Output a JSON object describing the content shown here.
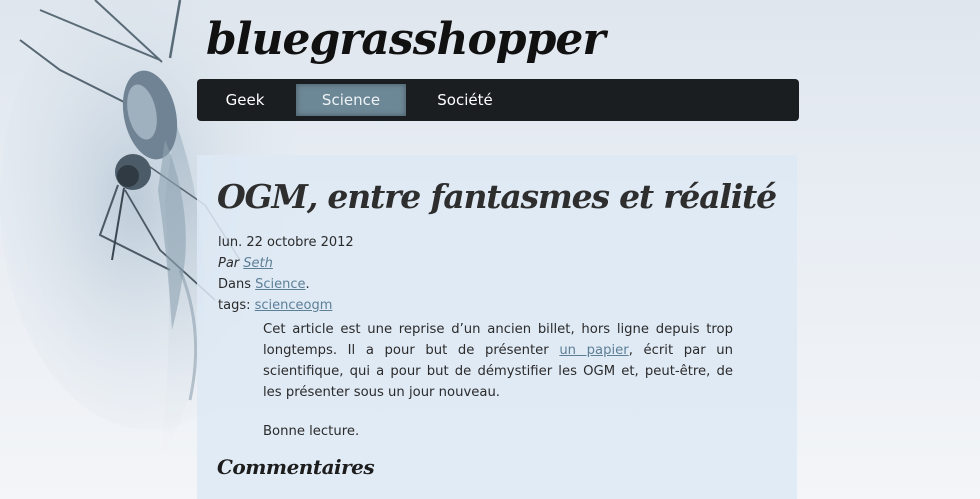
{
  "site": {
    "title": "bluegrasshopper"
  },
  "nav": {
    "items": [
      {
        "label": "Geek",
        "active": false
      },
      {
        "label": "Science",
        "active": true
      },
      {
        "label": "Société",
        "active": false
      }
    ]
  },
  "post": {
    "title": "OGM, entre fantasmes et réalité",
    "date": "lun. 22 octobre 2012",
    "author_prefix": "Par",
    "author": "Seth",
    "category_prefix": "Dans",
    "category": "Science",
    "category_suffix": ".",
    "tags_prefix": "tags:",
    "tags": [
      "science",
      "ogm"
    ],
    "paragraph1_before_link": "Cet article est une reprise d’un ancien billet, hors ligne depuis trop longtemps. Il a pour but de présenter",
    "paragraph1_link": "un papier",
    "paragraph1_after_link": ", écrit par un scientifique, qui a pour but de démystifier les OGM et, peut-être, de les présenter sous un jour nouveau.",
    "paragraph2": "Bonne lecture."
  },
  "comments": {
    "heading": "Commentaires"
  },
  "colors": {
    "nav_background": "#1b1e21",
    "nav_active": "#6c8796",
    "link": "#5d7f96",
    "panel": "#dde9f5"
  }
}
